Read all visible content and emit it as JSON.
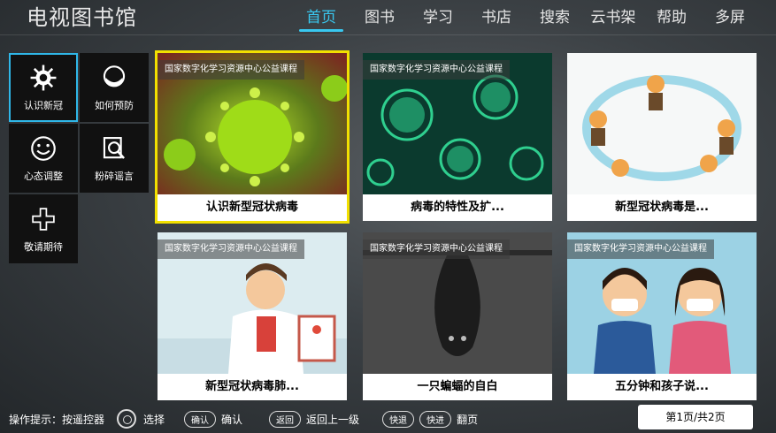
{
  "app": {
    "title": "电视图书馆"
  },
  "nav": [
    {
      "label": "首页",
      "active": true
    },
    {
      "label": "图书"
    },
    {
      "label": "学习"
    },
    {
      "label": "书店"
    },
    {
      "label": "搜索"
    },
    {
      "label": "云书架"
    },
    {
      "label": "帮助"
    },
    {
      "label": "多屏"
    }
  ],
  "sidebar": {
    "items": [
      {
        "label": "认识新冠",
        "icon": "virus-icon",
        "active": true
      },
      {
        "label": "如何预防",
        "icon": "mask-icon"
      },
      {
        "label": "心态调整",
        "icon": "smile-icon"
      },
      {
        "label": "粉碎谣言",
        "icon": "rumor-icon"
      },
      {
        "label": "敬请期待",
        "icon": "plus-icon"
      }
    ]
  },
  "cards": [
    {
      "badge": "国家数字化学习资源中心公益课程",
      "title": "认识新型冠状病毒",
      "focused": true
    },
    {
      "badge": "国家数字化学习资源中心公益课程",
      "title": "病毒的特性及扩..."
    },
    {
      "badge": "",
      "title": "新型冠状病毒是..."
    },
    {
      "badge": "国家数字化学习资源中心公益课程",
      "title": "新型冠状病毒肺..."
    },
    {
      "badge": "国家数字化学习资源中心公益课程",
      "title": "一只蝙蝠的自白"
    },
    {
      "badge": "国家数字化学习资源中心公益课程",
      "title": "五分钟和孩子说..."
    }
  ],
  "footer": {
    "hint": "操作提示：按遥控器",
    "select": "选择",
    "ok_btn": "确认",
    "ok": "确认",
    "back_btn": "返回",
    "back": "返回上一级",
    "rew_btn": "快退",
    "ff_btn": "快进",
    "page_turn": "翻页",
    "pager": "第1页/共2页"
  },
  "colors": {
    "accent": "#39c8f0",
    "focus": "#f2e000"
  }
}
